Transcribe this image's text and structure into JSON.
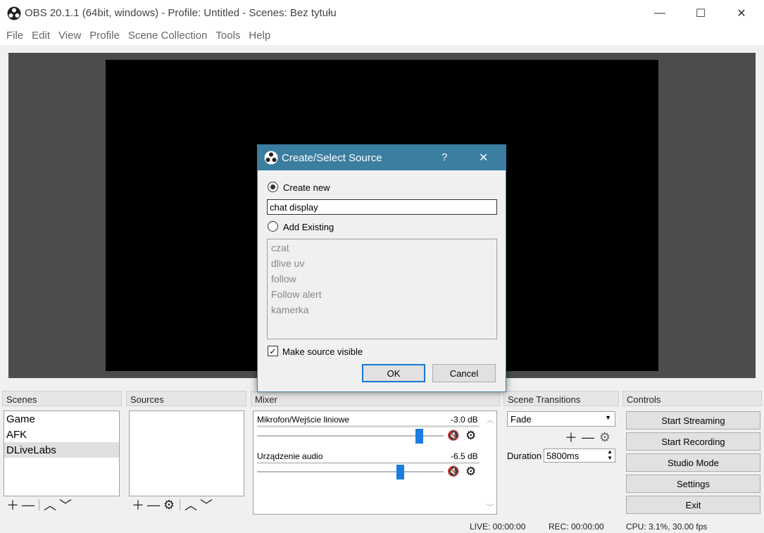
{
  "window": {
    "title": "OBS 20.1.1 (64bit, windows) - Profile: Untitled - Scenes: Bez tytułu",
    "minimize": "—",
    "maximize": "☐",
    "close": "✕"
  },
  "menu": [
    "File",
    "Edit",
    "View",
    "Profile",
    "Scene Collection",
    "Tools",
    "Help"
  ],
  "docks": {
    "scenes": "Scenes",
    "sources": "Sources",
    "mixer": "Mixer",
    "transitions": "Scene Transitions",
    "controls": "Controls"
  },
  "scenes": [
    {
      "label": "Game",
      "selected": false
    },
    {
      "label": "AFK",
      "selected": false
    },
    {
      "label": "DLiveLabs",
      "selected": true
    }
  ],
  "mixer": [
    {
      "name": "Mikrofon/Wejście liniowe",
      "db": "-3.0 dB",
      "level": 0.7
    },
    {
      "name": "Urządzenie audio",
      "db": "-6.5 dB",
      "level": 0.6
    }
  ],
  "transitions": {
    "selected": "Fade",
    "duration_label": "Duration",
    "duration_value": "5800ms"
  },
  "controls": {
    "start_streaming": "Start Streaming",
    "start_recording": "Start Recording",
    "studio_mode": "Studio Mode",
    "settings": "Settings",
    "exit": "Exit"
  },
  "status": {
    "live": "LIVE: 00:00:00",
    "rec": "REC: 00:00:00",
    "cpu": "CPU: 3.1%, 30.00 fps"
  },
  "dialog": {
    "title": "Create/Select Source",
    "help": "?",
    "close": "✕",
    "create_new": "Create new",
    "name_value": "chat display",
    "add_existing": "Add Existing",
    "existing": [
      "czat",
      "dlive uv",
      "follow",
      "Follow alert",
      "kamerka"
    ],
    "make_visible": "Make source visible",
    "ok": "OK",
    "cancel": "Cancel"
  },
  "colors": {
    "accent": "#3a7ea0",
    "slider": "#1c7ce0",
    "mute": "#c00000"
  }
}
